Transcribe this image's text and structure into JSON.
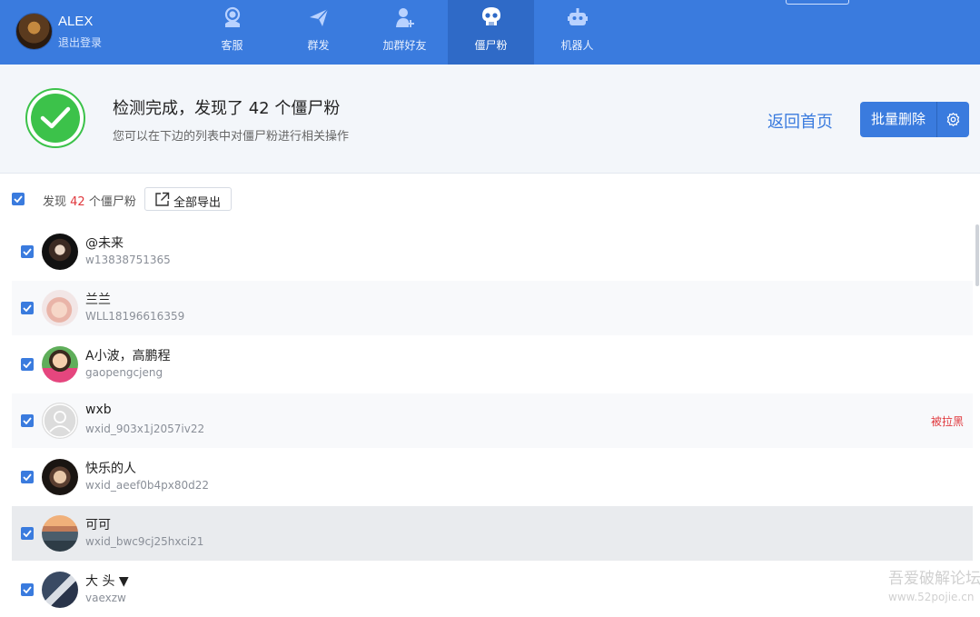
{
  "user": {
    "name": "ALEX",
    "logout_label": "退出登录"
  },
  "nav": [
    {
      "label": "客服",
      "icon": "headset-icon"
    },
    {
      "label": "群发",
      "icon": "send-icon"
    },
    {
      "label": "加群好友",
      "icon": "add-friend-icon"
    },
    {
      "label": "僵尸粉",
      "icon": "skull-icon",
      "active": true
    },
    {
      "label": "机器人",
      "icon": "robot-icon"
    }
  ],
  "banner": {
    "title": "检测完成，发现了 42 个僵尸粉",
    "subtitle": "您可以在下边的列表中对僵尸粉进行相关操作",
    "back_label": "返回首页",
    "batch_delete_label": "批量删除"
  },
  "toolbar": {
    "found_prefix": "发现",
    "found_count": "42",
    "found_suffix": "个僵尸粉",
    "export_label": "全部导出"
  },
  "contacts": [
    {
      "name": "@未来",
      "id": "w13838751365",
      "tag": "",
      "checked": true
    },
    {
      "name": "兰兰",
      "id": "WLL18196616359",
      "tag": "",
      "checked": true
    },
    {
      "name": "A小波，高鹏程",
      "id": "gaopengcjeng",
      "tag": "",
      "checked": true
    },
    {
      "name": "wxb",
      "id": "wxid_903x1j2057iv22",
      "tag": "被拉黑",
      "checked": true
    },
    {
      "name": "快乐的人",
      "id": "wxid_aeef0b4px80d22",
      "tag": "",
      "checked": true
    },
    {
      "name": "可可",
      "id": "wxid_bwc9cj25hxci21",
      "tag": "",
      "checked": true
    },
    {
      "name": "大 头 ▼",
      "id": "vaexzw",
      "tag": "",
      "checked": true
    }
  ],
  "watermark": {
    "text": "吾爱破解论坛",
    "url": "www.52pojie.cn"
  },
  "colors": {
    "primary": "#3a7bde",
    "success": "#3cc24a",
    "danger": "#e0393e"
  }
}
